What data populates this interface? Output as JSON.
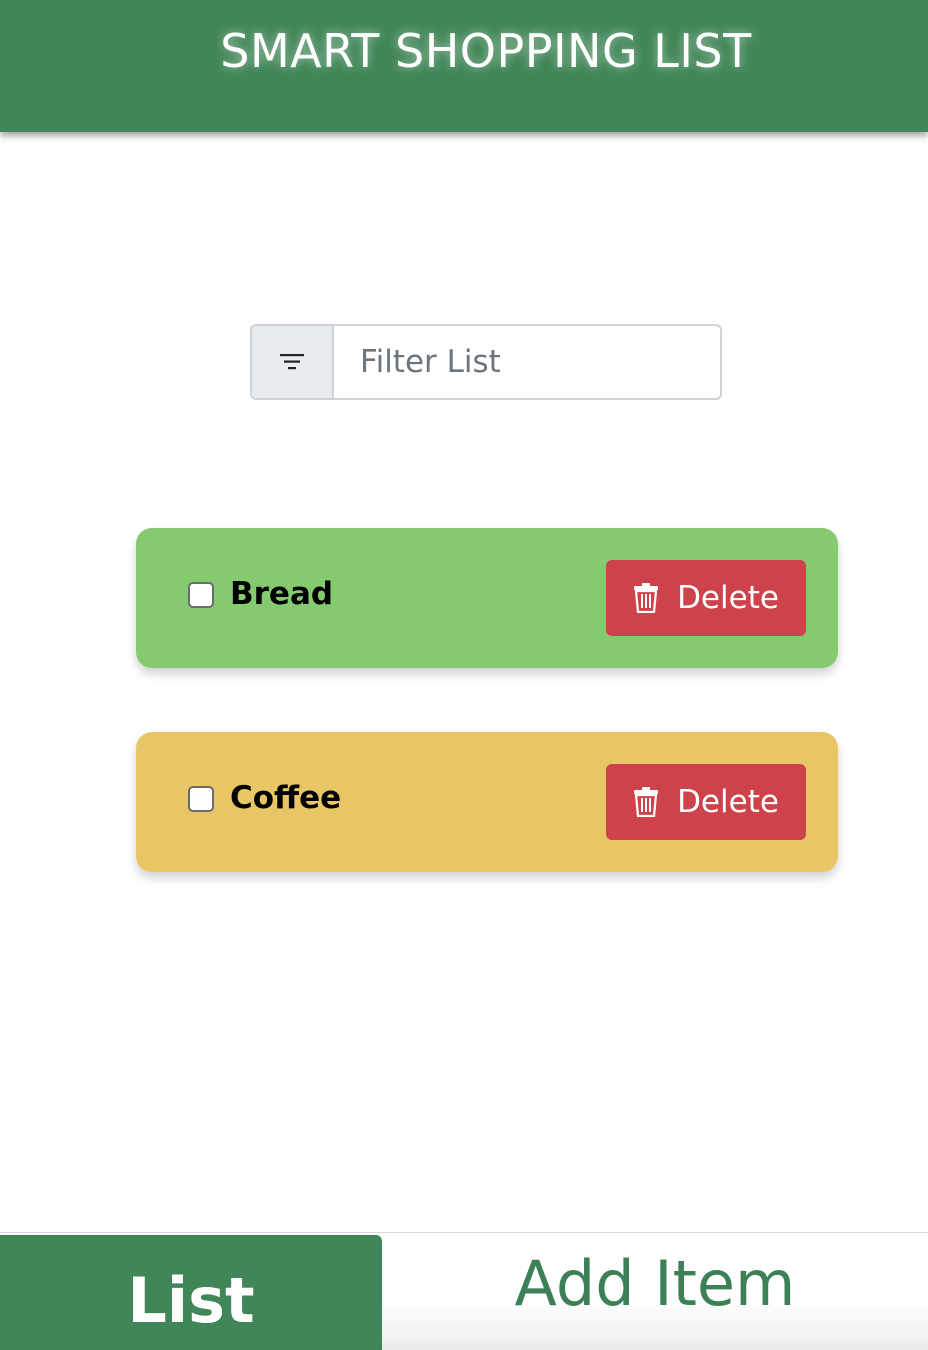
{
  "header": {
    "title": "SMART SHOPPING LIST"
  },
  "filter": {
    "placeholder": "Filter List",
    "value": ""
  },
  "items": [
    {
      "label": "Bread",
      "checked": false,
      "color": "#85ca6e",
      "delete_label": "Delete"
    },
    {
      "label": "Coffee",
      "checked": false,
      "color": "#e8c665",
      "delete_label": "Delete"
    }
  ],
  "tabs": [
    {
      "label": "List",
      "active": true
    },
    {
      "label": "Add Item",
      "active": false
    }
  ],
  "colors": {
    "brand": "#418658",
    "delete": "#cd424b"
  }
}
